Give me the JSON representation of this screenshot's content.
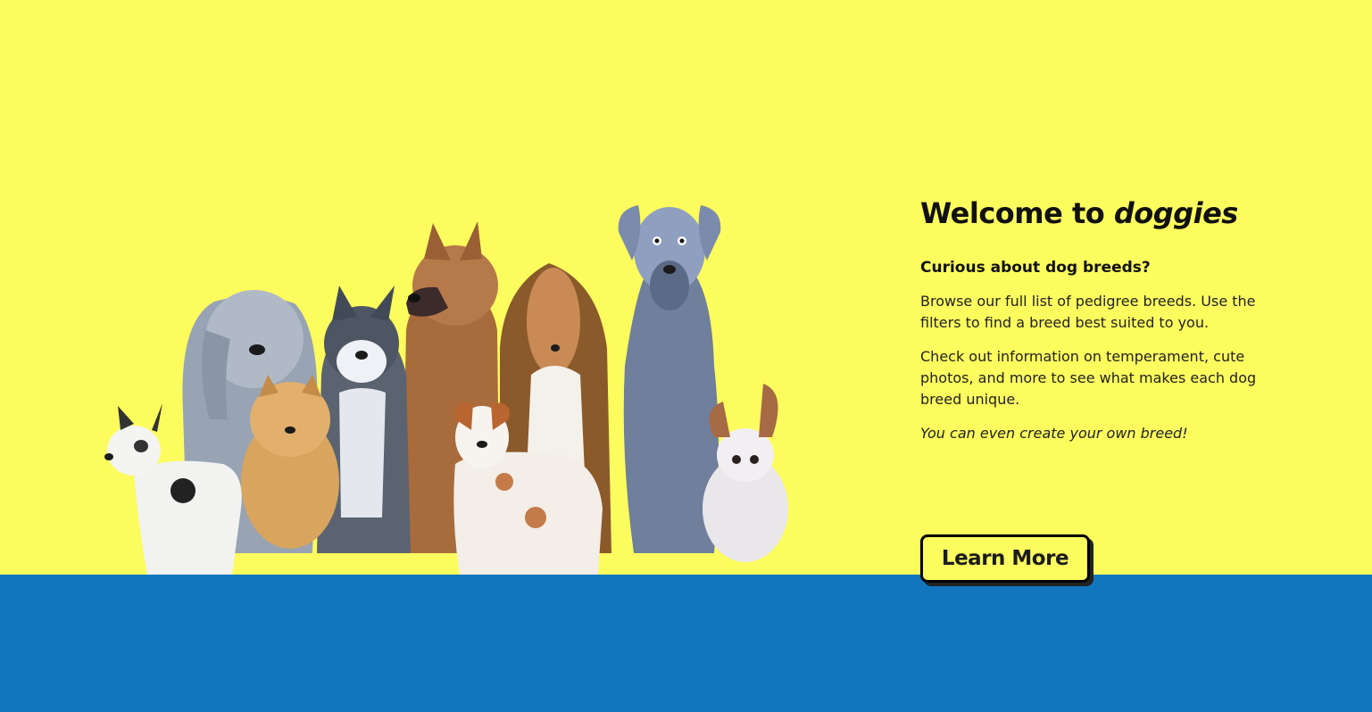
{
  "hero": {
    "title_prefix": "Welcome to ",
    "title_brand": "doggies",
    "subtitle": "Curious about dog breeds?",
    "paragraph1": "Browse our full list of pedigree breeds. Use the filters to find a breed best suited to you.",
    "paragraph2": "Check out information on temperament, cute photos, and more to see what makes each dog breed unique.",
    "paragraph3": "You can even create your own breed!",
    "cta_label": "Learn More",
    "illustration": "dog-breeds-illustration"
  },
  "colors": {
    "background_top": "#fdfc5e",
    "background_bottom": "#1276be",
    "text": "#111111"
  }
}
